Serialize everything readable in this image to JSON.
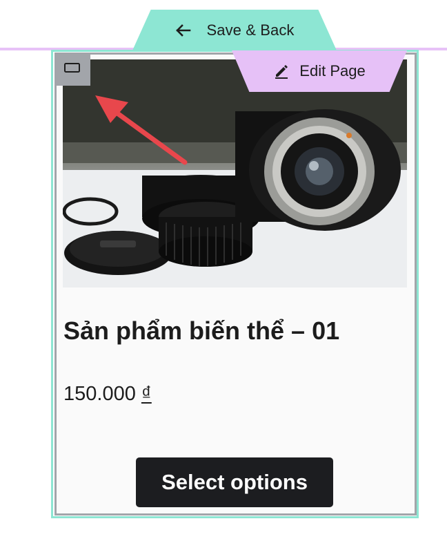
{
  "editor": {
    "save_back_label": "Save & Back",
    "edit_page_label": "Edit Page"
  },
  "product": {
    "title": "Sản phẩm biến thể – 01",
    "price_amount": "150.000",
    "price_currency": "₫",
    "select_options_label": "Select options"
  },
  "colors": {
    "save_back_tab": "#8de6d3",
    "edit_page_tab": "#e6c1f7",
    "annotation_arrow": "#e8474c",
    "button_bg": "#1c1d20"
  },
  "icons": {
    "save_back": "arrow-left-icon",
    "edit_page": "pencil-icon",
    "block_toggle": "rectangle-icon",
    "annotation": "red-arrow-annotation-icon"
  }
}
